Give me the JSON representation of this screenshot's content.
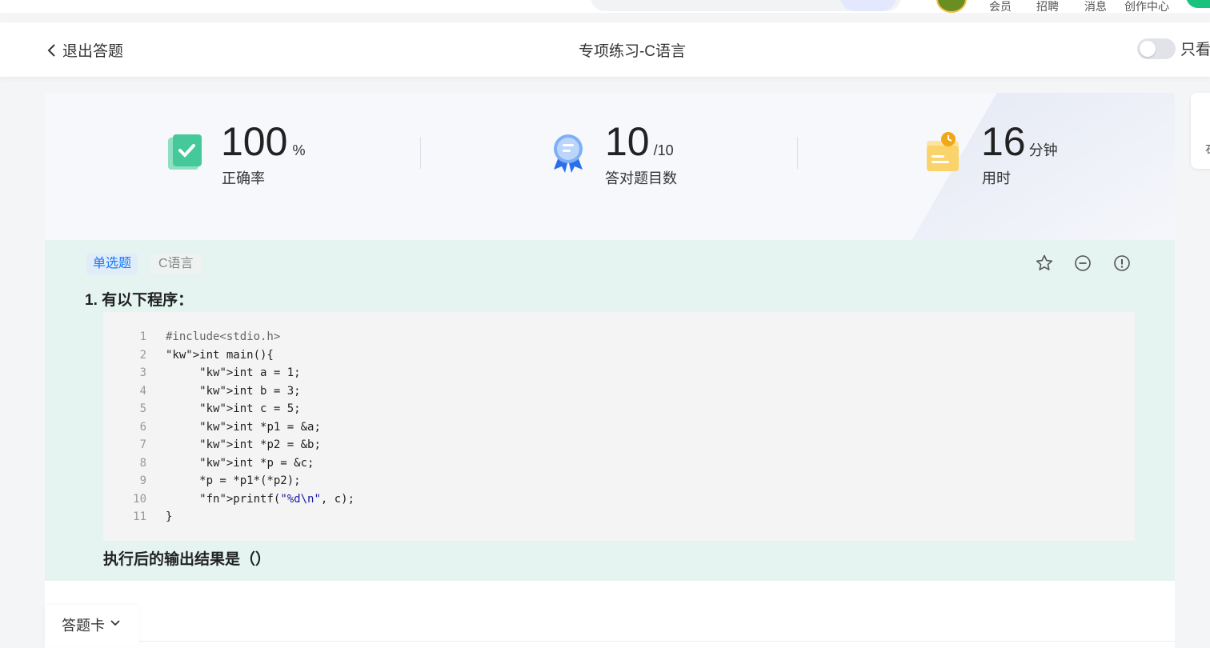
{
  "topnav": {
    "items": [
      "会员",
      "招聘",
      "消息",
      "创作中心"
    ]
  },
  "header": {
    "exit_label": "退出答题",
    "title": "专项练习-C语言",
    "toggle_label": "只看"
  },
  "side_card": {
    "label": "石"
  },
  "stats": {
    "accuracy": {
      "value": "100",
      "unit": "%",
      "label": "正确率"
    },
    "correct": {
      "value": "10",
      "unit": "/10",
      "label": "答对题目数"
    },
    "time": {
      "value": "16",
      "unit": "分钟",
      "label": "用时"
    }
  },
  "question": {
    "type_tag": "单选题",
    "subject_tag": "C语言",
    "title": "1. 有以下程序：",
    "prompt": "执行后的输出结果是（）",
    "icons": [
      "star-icon",
      "minus-circle-icon",
      "info-circle-icon"
    ],
    "code": [
      {
        "n": "1",
        "text": "#include<stdio.h>"
      },
      {
        "n": "2",
        "text": "int main(){"
      },
      {
        "n": "3",
        "text": "     int a = 1;"
      },
      {
        "n": "4",
        "text": "     int b = 3;"
      },
      {
        "n": "5",
        "text": "     int c = 5;"
      },
      {
        "n": "6",
        "text": "     int *p1 = &a;"
      },
      {
        "n": "7",
        "text": "     int *p2 = &b;"
      },
      {
        "n": "8",
        "text": "     int *p = &c;"
      },
      {
        "n": "9",
        "text": "     *p = *p1*(*p2);"
      },
      {
        "n": "10",
        "text": "     printf(\"%d\\n\", c);"
      },
      {
        "n": "11",
        "text": "}"
      }
    ]
  },
  "answer_card": {
    "label": "答题卡"
  },
  "colors": {
    "question_bg": "#e5f4f0",
    "tag_blue": "#1677ff",
    "printf_pink": "#d0188f",
    "string_blue": "#1a1aa6"
  }
}
